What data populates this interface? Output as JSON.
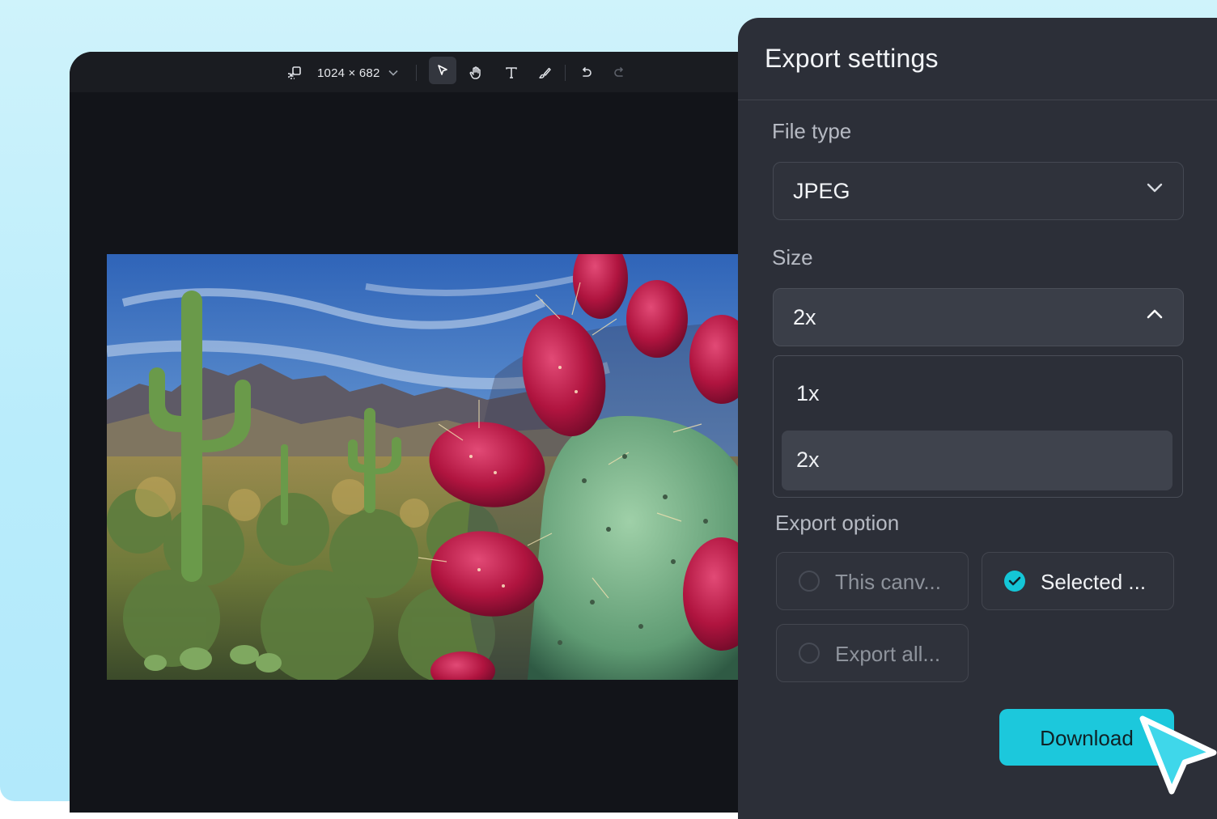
{
  "toolbar": {
    "canvas_size": "1024 × 682",
    "icons": [
      "resize-icon",
      "chevron-down-icon",
      "select-pointer-icon",
      "hand-icon",
      "text-tool-icon",
      "brush-icon",
      "undo-icon",
      "redo-icon"
    ]
  },
  "canvas": {
    "image_subject": "desert landscape with saguaro and prickly pear cactus"
  },
  "export_panel": {
    "title": "Export settings",
    "file_type": {
      "label": "File type",
      "value": "JPEG"
    },
    "size": {
      "label": "Size",
      "value": "2x",
      "options": [
        "1x",
        "2x"
      ],
      "selected": "2x"
    },
    "export_option": {
      "label": "Export option",
      "options": [
        {
          "label": "This canv...",
          "checked": false
        },
        {
          "label": "Selected ...",
          "checked": true
        },
        {
          "label": "Export all...",
          "checked": false
        }
      ]
    },
    "download_label": "Download"
  },
  "colors": {
    "accent": "#1cc8dc",
    "panel_bg": "#2c2f38",
    "editor_bg": "#121419",
    "page_bg": "#c5f0fb"
  }
}
